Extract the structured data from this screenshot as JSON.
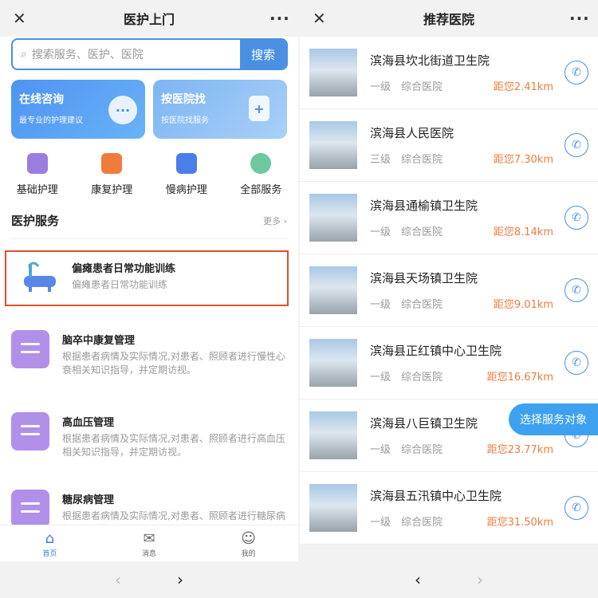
{
  "left": {
    "title": "医护上门",
    "search": {
      "placeholder": "搜索服务、医护、医院",
      "button": "搜索"
    },
    "cards": [
      {
        "title": "在线咨询",
        "subtitle": "最专业的护理建议"
      },
      {
        "title": "按医院找",
        "subtitle": "按医院找服务"
      }
    ],
    "categories": [
      {
        "label": "基础护理",
        "icon": "basic-care-icon",
        "color": "#9b7de0"
      },
      {
        "label": "康复护理",
        "icon": "rehab-care-icon",
        "color": "#f07c3c"
      },
      {
        "label": "慢病护理",
        "icon": "chronic-care-icon",
        "color": "#4a7ee8"
      },
      {
        "label": "全部服务",
        "icon": "all-services-icon",
        "color": "#6cc9a0"
      }
    ],
    "section": {
      "title": "医护服务",
      "more": "更多"
    },
    "services": [
      {
        "title": "偏瘫患者日常功能训练",
        "desc": "偏瘫患者日常功能训练"
      },
      {
        "title": "脑卒中康复管理",
        "desc": "根据患者病情及实际情况,对患者、照顾者进行慢性心衰相关知识指导，并定期访视。"
      },
      {
        "title": "高血压管理",
        "desc": "根据患者病情及实际情况,对患者、照顾者进行高血压相关知识指导，并定期访视。"
      },
      {
        "title": "糖尿病管理",
        "desc": "根据患者病情及实际情况,对患者、照顾者进行糖尿病相关知识指导，并定期访视。"
      }
    ],
    "tabs": [
      {
        "label": "首页",
        "icon": "home-icon"
      },
      {
        "label": "消息",
        "icon": "mail-icon"
      },
      {
        "label": "我的",
        "icon": "user-icon"
      }
    ]
  },
  "right": {
    "title": "推荐医院",
    "hospitals": [
      {
        "name": "滨海县坎北街道卫生院",
        "level": "一级",
        "type": "综合医院",
        "distance": "距您2.41km"
      },
      {
        "name": "滨海县人民医院",
        "level": "三级",
        "type": "综合医院",
        "distance": "距您7.30km"
      },
      {
        "name": "滨海县通榆镇卫生院",
        "level": "一级",
        "type": "综合医院",
        "distance": "距您8.14km"
      },
      {
        "name": "滨海县天场镇卫生院",
        "level": "一级",
        "type": "综合医院",
        "distance": "距您9.01km"
      },
      {
        "name": "滨海县正红镇中心卫生院",
        "level": "一级",
        "type": "综合医院",
        "distance": "距您16.67km"
      },
      {
        "name": "滨海县八巨镇卫生院",
        "level": "一级",
        "type": "综合医院",
        "distance": "距您23.77km"
      },
      {
        "name": "滨海县五汛镇中心卫生院",
        "level": "一级",
        "type": "综合医院",
        "distance": "距您31.50km"
      }
    ],
    "float_button": "选择服务对象"
  }
}
